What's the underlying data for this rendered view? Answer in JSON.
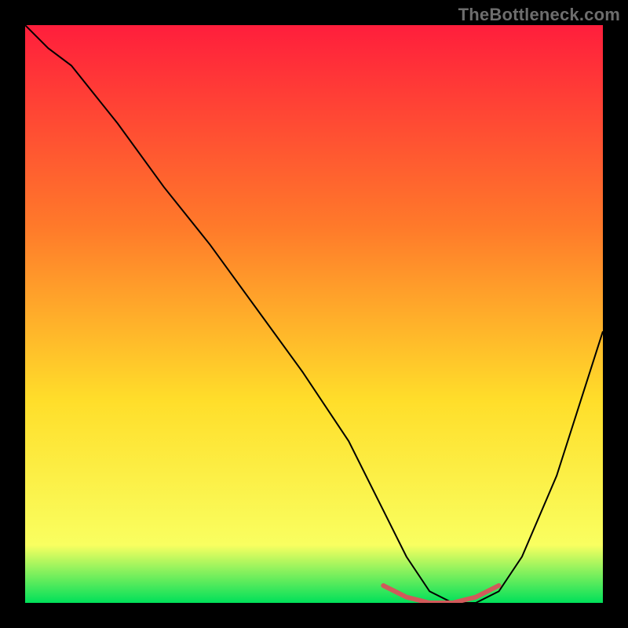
{
  "watermark": "TheBottleneck.com",
  "chart_data": {
    "type": "line",
    "title": "",
    "xlabel": "",
    "ylabel": "",
    "xlim": [
      0,
      100
    ],
    "ylim": [
      0,
      100
    ],
    "axes_shown": false,
    "background_gradient": {
      "top": "#ff1e3c",
      "mid1": "#ff7a2a",
      "mid2": "#ffde2a",
      "near_bottom": "#f9ff60",
      "bottom": "#00e05a"
    },
    "series": [
      {
        "name": "bottleneck-curve",
        "x": [
          0,
          4,
          8,
          16,
          24,
          32,
          40,
          48,
          56,
          62,
          66,
          70,
          74,
          78,
          82,
          86,
          92,
          100
        ],
        "values": [
          100,
          96,
          93,
          83,
          72,
          62,
          51,
          40,
          28,
          16,
          8,
          2,
          0,
          0,
          2,
          8,
          22,
          47
        ],
        "stroke": "#000000",
        "width": 2
      }
    ],
    "highlight": {
      "name": "optimal-range",
      "x": [
        62,
        66,
        70,
        74,
        78,
        82
      ],
      "values": [
        3,
        1,
        0,
        0,
        1,
        3
      ],
      "stroke": "#d15a5a",
      "width": 6
    }
  }
}
